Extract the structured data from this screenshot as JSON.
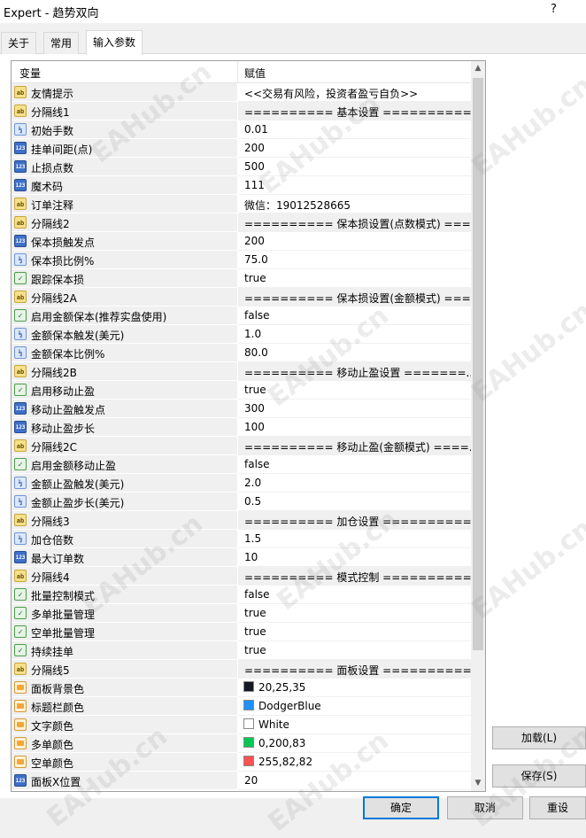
{
  "window": {
    "title": "Expert - 趋势双向",
    "help": "?"
  },
  "tabs": [
    {
      "label": "关于",
      "active": false
    },
    {
      "label": "常用",
      "active": false
    },
    {
      "label": "输入参数",
      "active": true
    }
  ],
  "grid": {
    "col_variable": "变量",
    "col_value": "赋值",
    "rows": [
      {
        "type": "ab",
        "name": "友情提示",
        "value": "<<交易有风险，投资者盈亏自负>>"
      },
      {
        "type": "ab",
        "name": "分隔线1",
        "value": "========== 基本设置 ==========",
        "sep": true
      },
      {
        "type": "dbl",
        "name": "初始手数",
        "value": "0.01"
      },
      {
        "type": "num",
        "name": "挂单间距(点)",
        "value": "200"
      },
      {
        "type": "num",
        "name": "止损点数",
        "value": "500"
      },
      {
        "type": "num",
        "name": "魔术码",
        "value": "111"
      },
      {
        "type": "ab",
        "name": "订单注释",
        "value": "微信：19012528665"
      },
      {
        "type": "ab",
        "name": "分隔线2",
        "value": "========== 保本损设置(点数模式) ===...",
        "sep": true
      },
      {
        "type": "num",
        "name": "保本损触发点",
        "value": "200"
      },
      {
        "type": "dbl",
        "name": "保本损比例%",
        "value": "75.0"
      },
      {
        "type": "bool",
        "name": "跟踪保本损",
        "value": "true"
      },
      {
        "type": "ab",
        "name": "分隔线2A",
        "value": "========== 保本损设置(金额模式) ===...",
        "sep": true
      },
      {
        "type": "bool",
        "name": "启用金额保本(推荐实盘使用)",
        "value": "false"
      },
      {
        "type": "dbl",
        "name": "金额保本触发(美元)",
        "value": "1.0"
      },
      {
        "type": "dbl",
        "name": "金额保本比例%",
        "value": "80.0"
      },
      {
        "type": "ab",
        "name": "分隔线2B",
        "value": "========== 移动止盈设置 =======...",
        "sep": true
      },
      {
        "type": "bool",
        "name": "启用移动止盈",
        "value": "true"
      },
      {
        "type": "num",
        "name": "移动止盈触发点",
        "value": "300"
      },
      {
        "type": "num",
        "name": "移动止盈步长",
        "value": "100"
      },
      {
        "type": "ab",
        "name": "分隔线2C",
        "value": "========== 移动止盈(金额模式) ====...",
        "sep": true
      },
      {
        "type": "bool",
        "name": "启用金额移动止盈",
        "value": "false"
      },
      {
        "type": "dbl",
        "name": "金额止盈触发(美元)",
        "value": "2.0"
      },
      {
        "type": "dbl",
        "name": "金额止盈步长(美元)",
        "value": "0.5"
      },
      {
        "type": "ab",
        "name": "分隔线3",
        "value": "========== 加仓设置 ==========",
        "sep": true
      },
      {
        "type": "dbl",
        "name": "加仓倍数",
        "value": "1.5"
      },
      {
        "type": "num",
        "name": "最大订单数",
        "value": "10"
      },
      {
        "type": "ab",
        "name": "分隔线4",
        "value": "========== 模式控制 ==========",
        "sep": true
      },
      {
        "type": "bool",
        "name": "批量控制模式",
        "value": "false"
      },
      {
        "type": "bool",
        "name": "多单批量管理",
        "value": "true"
      },
      {
        "type": "bool",
        "name": "空单批量管理",
        "value": "true"
      },
      {
        "type": "bool",
        "name": "持续挂单",
        "value": "true"
      },
      {
        "type": "ab",
        "name": "分隔线5",
        "value": "========== 面板设置 ==========",
        "sep": true
      },
      {
        "type": "clr",
        "name": "面板背景色",
        "value": "20,25,35",
        "swatch": "#141923"
      },
      {
        "type": "clr",
        "name": "标题栏颜色",
        "value": "DodgerBlue",
        "swatch": "#1e90ff"
      },
      {
        "type": "clr",
        "name": "文字颜色",
        "value": "White",
        "swatch": "#ffffff"
      },
      {
        "type": "clr",
        "name": "多单颜色",
        "value": "0,200,83",
        "swatch": "#00c853"
      },
      {
        "type": "clr",
        "name": "空单颜色",
        "value": "255,82,82",
        "swatch": "#ff5252"
      },
      {
        "type": "num",
        "name": "面板X位置",
        "value": "20"
      }
    ]
  },
  "icons": {
    "ab": "ab",
    "num": "123",
    "dbl": "½",
    "bool": "✓",
    "clr": ""
  },
  "buttons": {
    "load": "加载(L)",
    "save": "保存(S)",
    "ok": "确定",
    "cancel": "取消",
    "reset": "重设"
  },
  "watermark": "EAHub.cn"
}
